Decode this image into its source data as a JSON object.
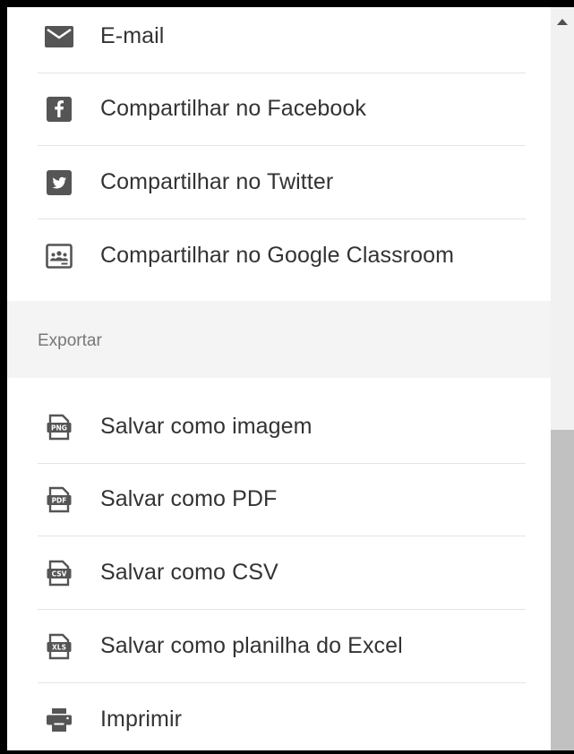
{
  "share_items": [
    {
      "label": "E-mail",
      "icon": "mail-icon"
    },
    {
      "label": "Compartilhar no Facebook",
      "icon": "facebook-icon"
    },
    {
      "label": "Compartilhar no Twitter",
      "icon": "twitter-icon"
    },
    {
      "label": "Compartilhar no Google Classroom",
      "icon": "google-classroom-icon"
    }
  ],
  "export_section": {
    "title": "Exportar",
    "items": [
      {
        "label": "Salvar como imagem",
        "icon": "png-file-icon",
        "badge": "PNG"
      },
      {
        "label": "Salvar como PDF",
        "icon": "pdf-file-icon",
        "badge": "PDF"
      },
      {
        "label": "Salvar como CSV",
        "icon": "csv-file-icon",
        "badge": "CSV"
      },
      {
        "label": "Salvar como planilha do Excel",
        "icon": "xls-file-icon",
        "badge": "XLS"
      },
      {
        "label": "Imprimir",
        "icon": "printer-icon"
      }
    ]
  },
  "colors": {
    "icon": "#555555",
    "text": "#333333",
    "section_bg": "#f4f4f4",
    "divider": "#e4e4e4"
  }
}
